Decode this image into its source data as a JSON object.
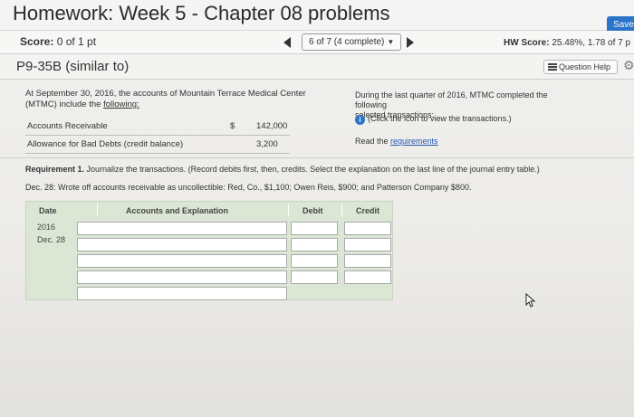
{
  "title": "Homework: Week 5 - Chapter 08 problems",
  "save_label": "Save",
  "score_label": "Score:",
  "score_value": "0 of 1 pt",
  "progress_label": "6 of 7 (4 complete)",
  "hw_score_label": "HW Score:",
  "hw_score_value": "25.48%, 1.78 of 7 p",
  "problem_id": "P9-35B (similar to)",
  "question_help_label": "Question Help",
  "intro_line1": "At September 30, 2016, the accounts of Mountain Terrace Medical Center",
  "intro_line2_a": "(MTMC) include the ",
  "intro_line2_b": "following:",
  "ledger": [
    {
      "account": "Accounts Receivable",
      "currency": "$",
      "amount": "142,000"
    },
    {
      "account": "Allowance for Bad Debts (credit balance)",
      "currency": "",
      "amount": "3,200"
    }
  ],
  "side_text_1": "During the last quarter of 2016, MTMC completed the following",
  "side_text_2": "selected transactions:",
  "info_text": "(Click the icon to view the transactions.)",
  "read_the": "Read the ",
  "requirements_link": "requirements",
  "req1_bold": "Requirement 1.",
  "req1_text": " Journalize the transactions. (Record debits first, then, credits. Select the explanation on the last line of the journal entry table.)",
  "dec28_text": "Dec. 28: Wrote off accounts receivable as uncollectible: Red, Co., $1,100; Owen Reis, $900; and Patterson Company $800.",
  "journal": {
    "col_date": "Date",
    "col_accounts": "Accounts and Explanation",
    "col_debit": "Debit",
    "col_credit": "Credit",
    "year": "2016",
    "date": "Dec. 28",
    "rows": 4
  },
  "colors": {
    "accent": "#2a74c9",
    "journal_bg": "#dbe6d4"
  }
}
